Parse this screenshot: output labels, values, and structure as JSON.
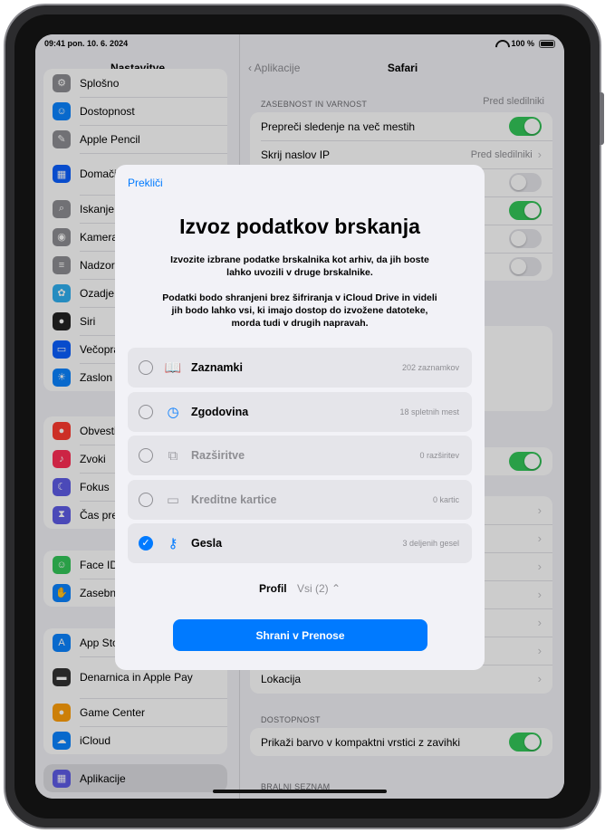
{
  "status": {
    "time": "09:41",
    "date": "pon. 10. 6. 2024",
    "battery": "100 %"
  },
  "sidebar": {
    "title": "Nastavitve",
    "items": [
      {
        "label": "Splošno",
        "color": "#8e8e93",
        "icon": "gear-icon"
      },
      {
        "label": "Dostopnost",
        "color": "#0a84ff",
        "icon": "accessibility-icon"
      },
      {
        "label": "Apple Pencil",
        "color": "#8e8e93",
        "icon": "pencil-icon"
      },
      {
        "label": "Domači zaslon in knjižnica",
        "color": "#0a60ff",
        "icon": "home-screen-icon"
      },
      {
        "label": "Iskanje",
        "color": "#8e8e93",
        "icon": "search-icon"
      },
      {
        "label": "Kamera",
        "color": "#8e8e93",
        "icon": "camera-icon"
      },
      {
        "label": "Nadzorni center",
        "color": "#8e8e93",
        "icon": "control-center-icon"
      },
      {
        "label": "Ozadje",
        "color": "#30b0f0",
        "icon": "wallpaper-icon"
      },
      {
        "label": "Siri",
        "color": "#222222",
        "icon": "siri-icon"
      },
      {
        "label": "Večopravilnost",
        "color": "#0a60ff",
        "icon": "multitasking-icon"
      },
      {
        "label": "Zaslon",
        "color": "#0a84ff",
        "icon": "display-icon"
      }
    ],
    "items2": [
      {
        "label": "Obvestila",
        "color": "#ff3b30",
        "icon": "notifications-icon"
      },
      {
        "label": "Zvoki",
        "color": "#ff2d55",
        "icon": "sounds-icon"
      },
      {
        "label": "Fokus",
        "color": "#5e5ce6",
        "icon": "moon-icon"
      },
      {
        "label": "Čas pred zaslonom",
        "color": "#5e5ce6",
        "icon": "hourglass-icon"
      }
    ],
    "items3": [
      {
        "label": "Face ID in koda",
        "color": "#34c759",
        "icon": "faceid-icon"
      },
      {
        "label": "Zasebnost",
        "color": "#0a84ff",
        "icon": "hand-icon"
      }
    ],
    "items4": [
      {
        "label": "App Store",
        "color": "#0a84ff",
        "icon": "appstore-icon"
      },
      {
        "label": "Denarnica in Apple Pay",
        "color": "#333333",
        "icon": "wallet-icon"
      },
      {
        "label": "Game Center",
        "color": "#ff9f0a",
        "icon": "gamecenter-icon"
      },
      {
        "label": "iCloud",
        "color": "#0a84ff",
        "icon": "cloud-icon"
      }
    ],
    "apps": {
      "label": "Aplikacije",
      "color": "#5e5ce6",
      "icon": "apps-icon"
    }
  },
  "detail": {
    "back": "Aplikacije",
    "title": "Safari",
    "privacy_header": "ZASEBNOST IN VARNOST",
    "privacy_right": "Pred sledilniki",
    "rows": [
      {
        "label": "Prepreči sledenje na več mestih",
        "type": "toggle",
        "on": true
      },
      {
        "label": "Skrij naslov IP",
        "type": "value",
        "value": "Pred sledilniki"
      },
      {
        "label": "",
        "type": "toggle",
        "on": false
      },
      {
        "label": "",
        "type": "toggle",
        "on": true
      },
      {
        "label": "",
        "type": "toggle",
        "on": false
      },
      {
        "label": "",
        "type": "toggle",
        "on": false
      }
    ],
    "location": "Lokacija",
    "access_header": "DOSTOPNOST",
    "access_row": "Prikaži barvo v kompaktni vrstici z zavihki",
    "reading_header": "BRALNI SEZNAM"
  },
  "modal": {
    "cancel": "Prekliči",
    "title": "Izvoz podatkov brskanja",
    "desc1": "Izvozite izbrane podatke brskalnika kot arhiv, da jih boste lahko uvozili v druge brskalnike.",
    "desc2": "Podatki bodo shranjeni brez šifriranja v iCloud Drive in videli jih bodo lahko vsi, ki imajo dostop do izvožene datoteke, morda tudi v drugih napravah.",
    "options": [
      {
        "label": "Zaznamki",
        "count": "202 zaznamkov",
        "icon": "book-icon",
        "checked": false,
        "disabled": false,
        "glyph": "📖"
      },
      {
        "label": "Zgodovina",
        "count": "18 spletnih mest",
        "icon": "clock-icon",
        "checked": false,
        "disabled": false,
        "glyph": "◷"
      },
      {
        "label": "Razširitve",
        "count": "0 razširitev",
        "icon": "puzzle-icon",
        "checked": false,
        "disabled": true,
        "glyph": "⧉"
      },
      {
        "label": "Kreditne kartice",
        "count": "0 kartic",
        "icon": "credit-card-icon",
        "checked": false,
        "disabled": true,
        "glyph": "▭"
      },
      {
        "label": "Gesla",
        "count": "3 deljenih gesel",
        "icon": "key-icon",
        "checked": true,
        "disabled": false,
        "glyph": "⚷"
      }
    ],
    "profile_label": "Profil",
    "profile_value": "Vsi (2) ⌃",
    "save": "Shrani v Prenose"
  }
}
